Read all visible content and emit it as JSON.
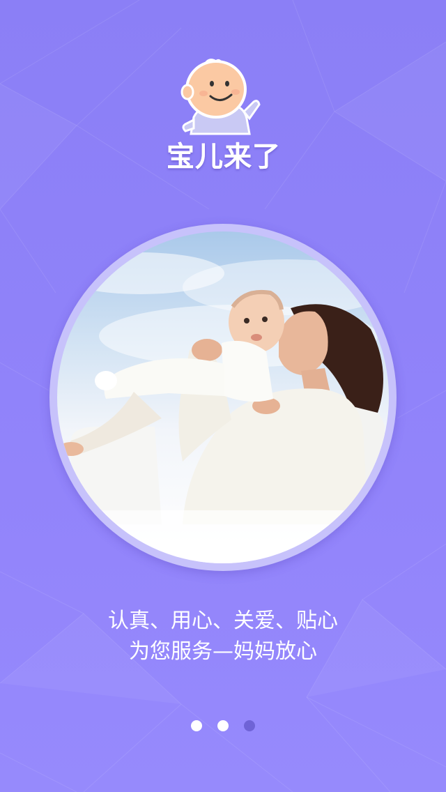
{
  "app": {
    "logo_text": "宝儿来了",
    "logo_icon": "baby-mascot-icon"
  },
  "slide": {
    "image": "mother-kissing-baby-photo",
    "tagline_line1": "认真、用心、关爱、贴心",
    "tagline_line2": "为您服务—妈妈放心"
  },
  "pager": {
    "total": 3,
    "active_indices": [
      0,
      1
    ],
    "active_color": "#ffffff",
    "inactive_color": "#6f63d6"
  },
  "colors": {
    "background": "#8f82f9",
    "photo_ring": "#c7c2fb"
  }
}
